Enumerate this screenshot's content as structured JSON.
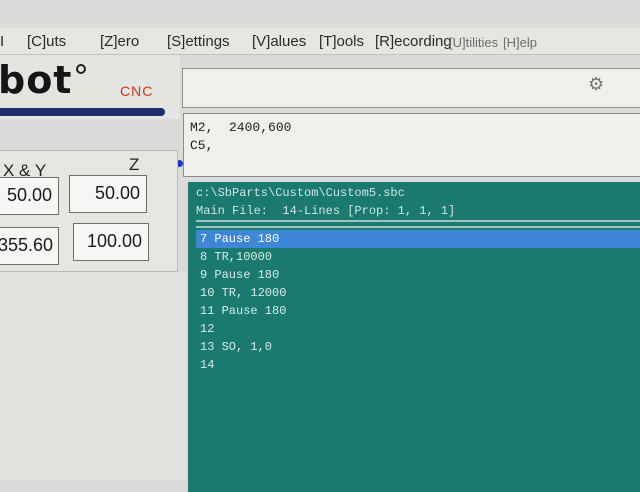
{
  "menu": {
    "items": [
      {
        "label": "I"
      },
      {
        "label": "[C]uts"
      },
      {
        "label": "[Z]ero"
      },
      {
        "label": "[S]ettings"
      },
      {
        "label": "[V]alues"
      },
      {
        "label": "[T]ools"
      },
      {
        "label": "[R]ecording"
      },
      {
        "label": "[U]tilities"
      },
      {
        "label": "[H]elp"
      }
    ]
  },
  "logo": {
    "text": "bot",
    "suffix": "CNC",
    "colors": {
      "text": "#161616",
      "swoosh": "#1f2e6b",
      "suffix": "#d2321e"
    }
  },
  "command": {
    "lines": [
      "M2,  2400,600",
      "C5,"
    ]
  },
  "position": {
    "xy_label": "X & Y",
    "z_label": "Z",
    "x_value": "50.00",
    "z_value": "50.00",
    "y_value": "355.60",
    "z2_value": "100.00"
  },
  "file": {
    "path": "c:\\SbParts\\Custom\\Custom5.sbc",
    "info": "Main File:  14-Lines [Prop: 1, 1, 1]",
    "lines": [
      {
        "num": "7",
        "text": "Pause 180"
      },
      {
        "num": "8",
        "text": "TR,10000"
      },
      {
        "num": "9",
        "text": "Pause 180"
      },
      {
        "num": "10",
        "text": "TR, 12000"
      },
      {
        "num": "11",
        "text": "Pause 180"
      },
      {
        "num": "12",
        "text": ""
      },
      {
        "num": "13",
        "text": "SO, 1,0"
      },
      {
        "num": "14",
        "text": ""
      }
    ],
    "selected_index": 0,
    "colors": {
      "background": "#1a7a70",
      "highlight": "#3e86d6"
    }
  }
}
